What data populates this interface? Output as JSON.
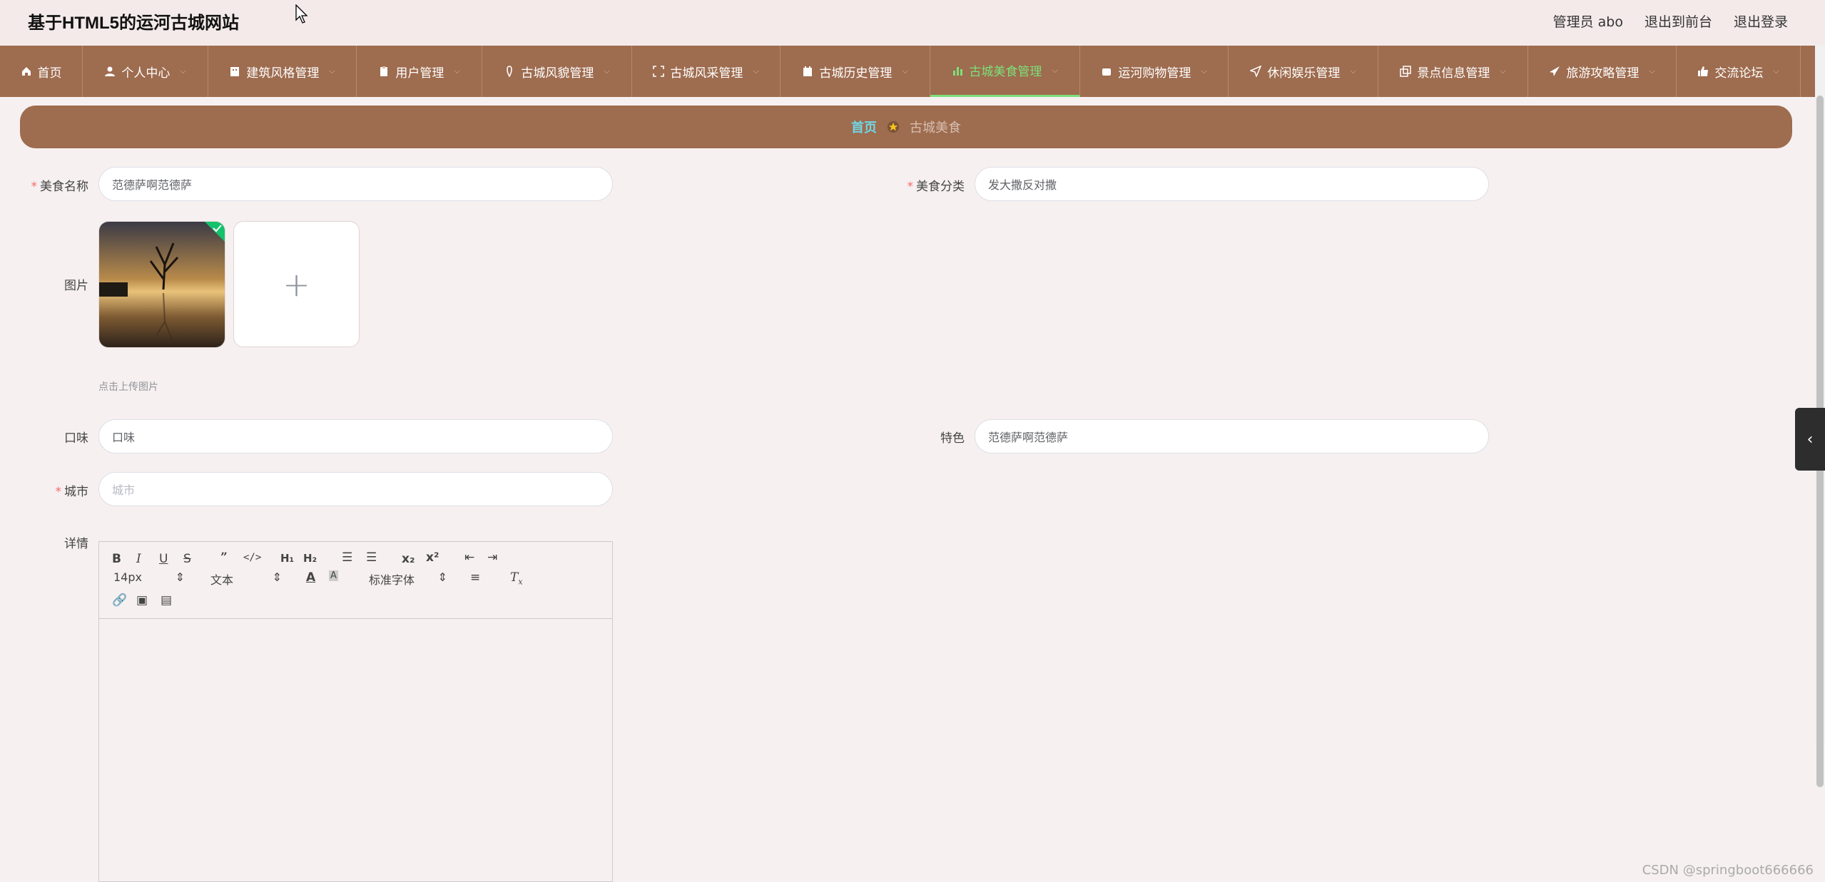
{
  "header": {
    "site_title": "基于HTML5的运河古城网站",
    "admin": "管理员 abo",
    "to_front": "退出到前台",
    "logout": "退出登录"
  },
  "nav": {
    "items": [
      {
        "label": "首页",
        "icon": "home-icon"
      },
      {
        "label": "个人中心",
        "icon": "user-icon"
      },
      {
        "label": "建筑风格管理",
        "icon": "building-icon"
      },
      {
        "label": "用户管理",
        "icon": "clipboard-icon"
      },
      {
        "label": "古城风貌管理",
        "icon": "pin-icon"
      },
      {
        "label": "古城风采管理",
        "icon": "frame-icon"
      },
      {
        "label": "古城历史管理",
        "icon": "calendar-icon"
      },
      {
        "label": "古城美食管理",
        "icon": "chart-icon"
      },
      {
        "label": "运河购物管理",
        "icon": "bag-icon"
      },
      {
        "label": "休闲娱乐管理",
        "icon": "send-icon"
      },
      {
        "label": "景点信息管理",
        "icon": "copy-icon"
      },
      {
        "label": "旅游攻略管理",
        "icon": "plane-icon"
      },
      {
        "label": "交流论坛",
        "icon": "thumb-icon"
      }
    ]
  },
  "breadcrumb": {
    "home": "首页",
    "current": "古城美食"
  },
  "form": {
    "name_label": "美食名称",
    "name_value": "范德萨啊范德萨",
    "category_label": "美食分类",
    "category_value": "发大撒反对撒",
    "image_label": "图片",
    "upload_tip": "点击上传图片",
    "taste_label": "口味",
    "taste_value": "口味",
    "feature_label": "特色",
    "feature_value": "范德萨啊范德萨",
    "city_label": "城市",
    "city_placeholder": "城市",
    "detail_label": "详情"
  },
  "editor": {
    "font_size": "14px",
    "header_select": "文本",
    "font_family": "标准字体"
  },
  "watermark": "CSDN @springboot666666",
  "colors": {
    "brand": "#9e6c4f",
    "active_nav": "#7ce07a",
    "required": "#f56c6c"
  }
}
